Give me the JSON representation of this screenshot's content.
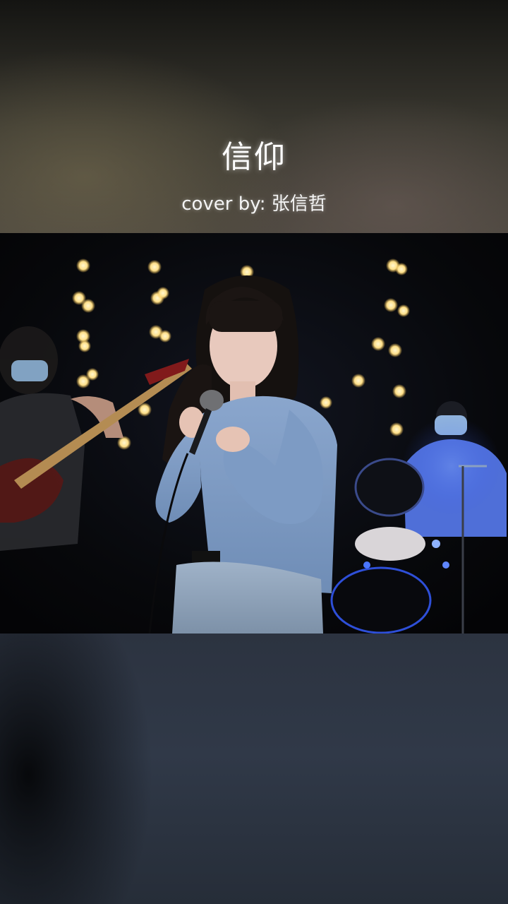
{
  "header": {
    "title": "信仰",
    "cover_credit": "cover by: 张信哲"
  },
  "video": {
    "content": "live band performance",
    "accent_colors": {
      "sweater": "#7f9cc4",
      "stage_light": "#ffe7a3",
      "drum_light": "#2f5bff"
    }
  }
}
